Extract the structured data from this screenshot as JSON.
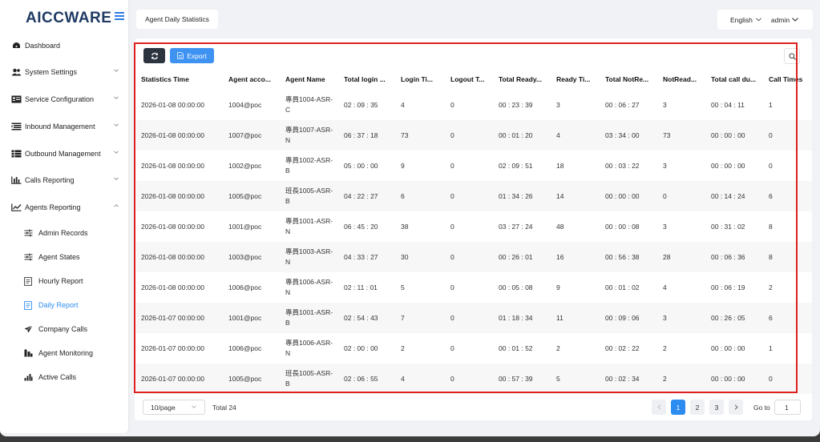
{
  "app": {
    "logo": "AICCWARE"
  },
  "sidebar": {
    "items": [
      {
        "label": "Dashboard",
        "icon": "dashboard-icon"
      },
      {
        "label": "System Settings",
        "icon": "users-icon"
      },
      {
        "label": "Service Configuration",
        "icon": "config-icon"
      },
      {
        "label": "Inbound Management",
        "icon": "inbound-icon"
      },
      {
        "label": "Outbound Management",
        "icon": "outbound-icon"
      },
      {
        "label": "Calls Reporting",
        "icon": "bar-chart-icon"
      },
      {
        "label": "Agents Reporting",
        "icon": "line-chart-icon"
      }
    ],
    "subitems": [
      {
        "label": "Admin Records",
        "icon": "sliders-icon"
      },
      {
        "label": "Agent States",
        "icon": "sliders-icon"
      },
      {
        "label": "Hourly Report",
        "icon": "report-icon"
      },
      {
        "label": "Daily Report",
        "icon": "report-icon",
        "active": true
      },
      {
        "label": "Company Calls",
        "icon": "send-icon"
      },
      {
        "label": "Agent Monitoring",
        "icon": "monitor-icon"
      },
      {
        "label": "Active Calls",
        "icon": "signal-icon"
      }
    ]
  },
  "header": {
    "tab": "Agent Daily Statistics",
    "language": "English",
    "user": "admin"
  },
  "toolbar": {
    "export_label": "Export"
  },
  "table": {
    "columns": [
      "Statistics Time",
      "Agent acco...",
      "Agent Name",
      "Total login ...",
      "Login Ti...",
      "Logout T...",
      "Total Ready...",
      "Ready Ti...",
      "Total NotRe...",
      "NotRead...",
      "Total call du...",
      "Call Times"
    ],
    "rows": [
      [
        "2026-01-08 00:00:00",
        "1004@poc",
        "專員1004-ASR-C",
        "02 : 09 : 35",
        "4",
        "0",
        "00 : 23 : 39",
        "3",
        "00 : 06 : 27",
        "3",
        "00 : 04 : 11",
        "1"
      ],
      [
        "2026-01-08 00:00:00",
        "1007@poc",
        "專員1007-ASR-N",
        "06 : 37 : 18",
        "73",
        "0",
        "00 : 01 : 20",
        "4",
        "03 : 34 : 00",
        "73",
        "00 : 00 : 00",
        "0"
      ],
      [
        "2026-01-08 00:00:00",
        "1002@poc",
        "專員1002-ASR-B",
        "05 : 00 : 00",
        "9",
        "0",
        "02 : 09 : 51",
        "18",
        "00 : 03 : 22",
        "3",
        "00 : 00 : 00",
        "0"
      ],
      [
        "2026-01-08 00:00:00",
        "1005@poc",
        "班長1005-ASR-B",
        "04 : 22 : 27",
        "6",
        "0",
        "01 : 34 : 26",
        "14",
        "00 : 00 : 00",
        "0",
        "00 : 14 : 24",
        "6"
      ],
      [
        "2026-01-08 00:00:00",
        "1001@poc",
        "專員1001-ASR-N",
        "06 : 45 : 20",
        "38",
        "0",
        "03 : 27 : 24",
        "48",
        "00 : 00 : 08",
        "3",
        "00 : 31 : 02",
        "8"
      ],
      [
        "2026-01-08 00:00:00",
        "1003@poc",
        "專員1003-ASR-N",
        "04 : 33 : 27",
        "30",
        "0",
        "00 : 26 : 01",
        "16",
        "00 : 56 : 38",
        "28",
        "00 : 06 : 36",
        "8"
      ],
      [
        "2026-01-08 00:00:00",
        "1006@poc",
        "專員1006-ASR-N",
        "02 : 11 : 01",
        "5",
        "0",
        "00 : 05 : 08",
        "9",
        "00 : 01 : 02",
        "4",
        "00 : 06 : 19",
        "2"
      ],
      [
        "2026-01-07 00:00:00",
        "1001@poc",
        "專員1001-ASR-B",
        "02 : 54 : 43",
        "7",
        "0",
        "01 : 18 : 34",
        "11",
        "00 : 09 : 06",
        "3",
        "00 : 26 : 05",
        "6"
      ],
      [
        "2026-01-07 00:00:00",
        "1006@poc",
        "專員1006-ASR-N",
        "02 : 00 : 00",
        "2",
        "0",
        "00 : 01 : 52",
        "2",
        "00 : 02 : 22",
        "2",
        "00 : 00 : 00",
        "1"
      ],
      [
        "2026-01-07 00:00:00",
        "1005@poc",
        "班長1005-ASR-B",
        "02 : 06 : 55",
        "4",
        "0",
        "00 : 57 : 39",
        "5",
        "00 : 02 : 34",
        "2",
        "00 : 00 : 00",
        "0"
      ]
    ]
  },
  "pagination": {
    "page_size": "10/page",
    "total": "Total 24",
    "pages": [
      "1",
      "2",
      "3"
    ],
    "goto_label": "Go to",
    "goto_value": "1"
  },
  "colors": {
    "accent": "#2d8cf0",
    "highlight": "#e02020",
    "dark_button": "#2c3440"
  }
}
